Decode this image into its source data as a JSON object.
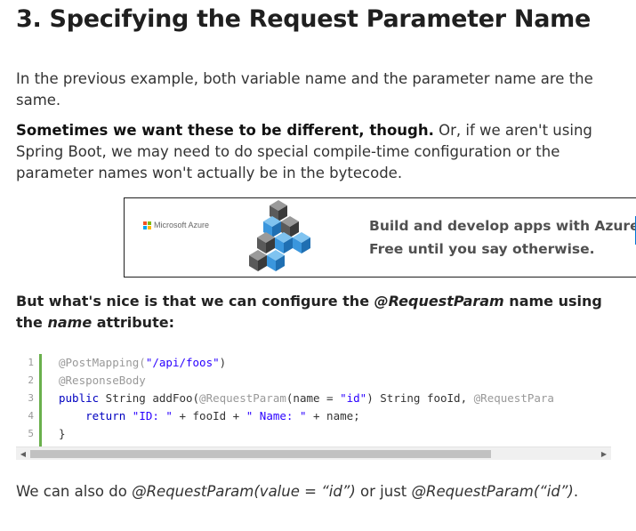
{
  "heading": "3. Specifying the Request Parameter Name",
  "p1": "In the previous example, both variable name and the parameter name are the same.",
  "p2": {
    "bold": "Sometimes we want these to be different, though.",
    "rest": " Or, if we aren't using Spring Boot, we may need to do special compile-time configuration or the parameter names won't actually be in the bytecode."
  },
  "ad": {
    "brand": "Microsoft Azure",
    "line1": "Build and develop apps with Azure.",
    "line2": "Free until you say otherwise.",
    "colors": {
      "ms_red": "#f25022",
      "ms_green": "#7fba00",
      "ms_blue": "#00a4ef",
      "ms_yellow": "#ffb900",
      "cube_blue": "#3a96dd",
      "cube_dark": "#505050",
      "accent": "#0078d4"
    }
  },
  "p3": {
    "t1": "But what's nice is that we can configure the ",
    "i1": "@RequestParam",
    "t2": " name using the ",
    "i2": "name",
    "t3": " attribute:"
  },
  "code": {
    "line_numbers": [
      "1",
      "2",
      "3",
      "4",
      "5"
    ],
    "l1": {
      "ann": "@PostMapping(",
      "str": "\"/api/foos\"",
      "end": ")"
    },
    "l2": {
      "ann": "@ResponseBody"
    },
    "l3": {
      "kw": "public",
      "t1": " String addFoo(",
      "ann1": "@RequestParam",
      "t2": "(name = ",
      "str": "\"id\"",
      "t3": ") String fooId, ",
      "ann2": "@RequestPara"
    },
    "l4": {
      "indent": "    ",
      "kw": "return",
      "t1": " ",
      "s1": "\"ID: \"",
      "t2": " + fooId + ",
      "s2": "\" Name: \"",
      "t3": " + name;"
    },
    "l5": {
      "t1": "}"
    },
    "gutter_color": "#6ab04c"
  },
  "scrollbar": {
    "left_arrow": "◀",
    "right_arrow": "▶"
  },
  "p4": {
    "t1": "We can also do ",
    "i1": "@RequestParam(value = “id”)",
    "t2": " or just ",
    "i2": "@RequestParam(“id”)",
    "t3": "."
  }
}
